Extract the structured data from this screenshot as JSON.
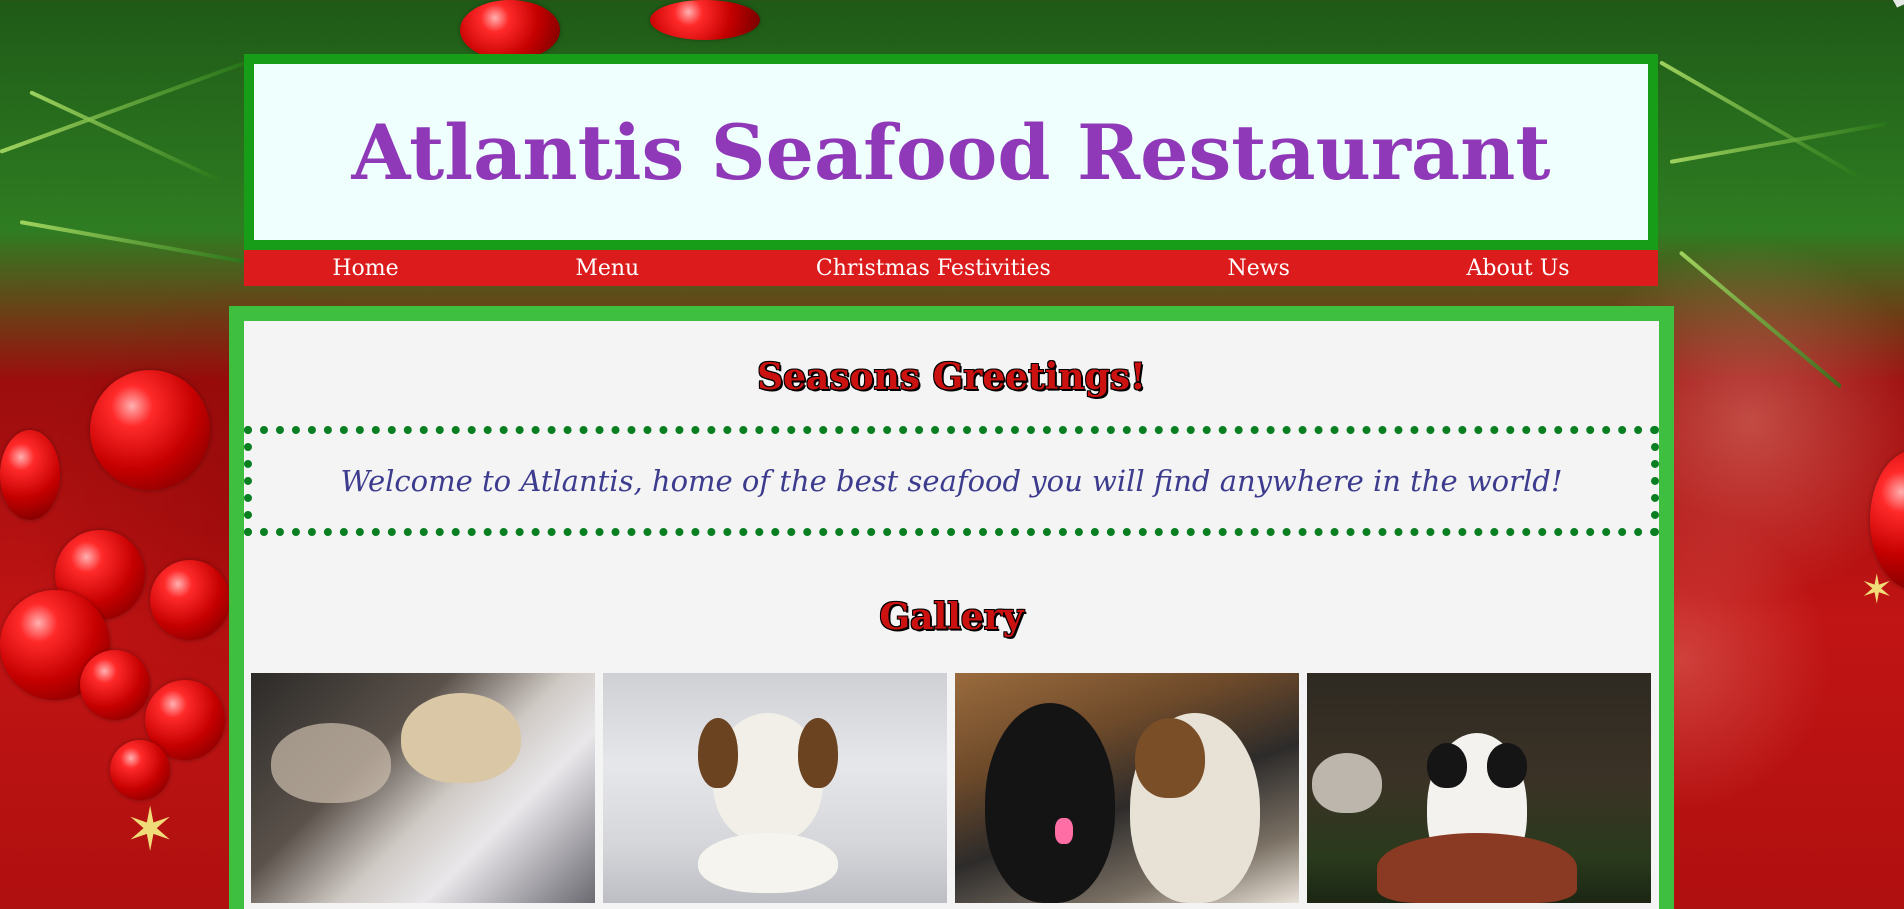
{
  "site": {
    "title": "Atlantis Seafood Restaurant"
  },
  "nav": {
    "items": [
      {
        "label": "Home"
      },
      {
        "label": "Menu"
      },
      {
        "label": "Christmas Festivities"
      },
      {
        "label": "News"
      },
      {
        "label": "About Us"
      }
    ]
  },
  "main": {
    "greeting_heading": "Seasons Greetings!",
    "welcome_text": "Welcome to Atlantis, home of the best seafood you will find anywhere in the world!",
    "gallery_heading": "Gallery",
    "gallery_images": [
      {
        "description_icon": "sleeping-dog-photo"
      },
      {
        "description_icon": "white-brown-dog-photo"
      },
      {
        "description_icon": "two-dogs-photo"
      },
      {
        "description_icon": "puppy-in-bowl-photo"
      }
    ]
  },
  "colors": {
    "title": "#9039b8",
    "header_border": "#179d17",
    "nav_bg": "#dc1c1c",
    "main_border": "#3fbf3f",
    "heading_red": "#cc1111",
    "welcome_text": "#3c3b8e",
    "dotted_border": "#0a7f22"
  }
}
